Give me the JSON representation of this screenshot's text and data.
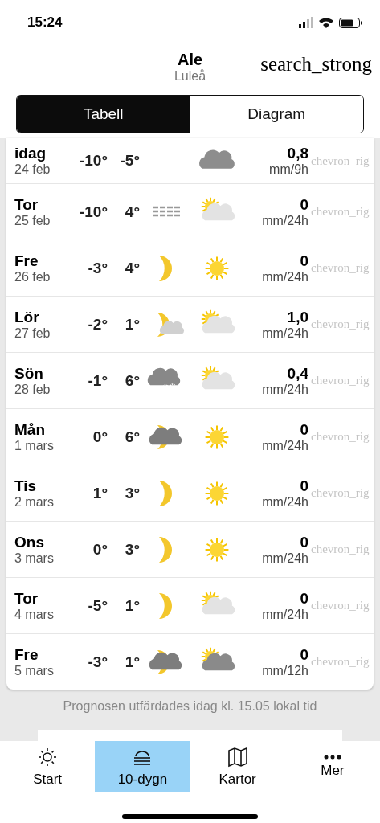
{
  "status_bar": {
    "time": "15:24"
  },
  "header": {
    "title": "Ale",
    "subtitle": "Luleå",
    "search_label": "search_strong"
  },
  "tabs": [
    {
      "label": "Tabell",
      "selected": true
    },
    {
      "label": "Diagram",
      "selected": false
    }
  ],
  "rows": [
    {
      "day": "idag",
      "date": "24 feb",
      "low": "-10°",
      "high": "-5°",
      "day_icon": {
        "kind": "cloud"
      },
      "amount": "0,8",
      "unit": "mm/9h",
      "chevron": "chevron_rig"
    },
    {
      "day": "Tor",
      "date": "25 feb",
      "low": "-10°",
      "high": "4°",
      "night_icon": {
        "kind": "fog"
      },
      "day_icon": {
        "kind": "partlycloudy"
      },
      "amount": "0",
      "unit": "mm/24h",
      "chevron": "chevron_rig"
    },
    {
      "day": "Fre",
      "date": "26 feb",
      "low": "-3°",
      "high": "4°",
      "night_icon": {
        "kind": "moon"
      },
      "day_icon": {
        "kind": "sun"
      },
      "amount": "0",
      "unit": "mm/24h",
      "chevron": "chevron_rig"
    },
    {
      "day": "Lör",
      "date": "27 feb",
      "low": "-2°",
      "high": "1°",
      "night_icon": {
        "kind": "mooncloud"
      },
      "day_icon": {
        "kind": "partlycloudy"
      },
      "amount": "1,0",
      "unit": "mm/24h",
      "chevron": "chevron_rig"
    },
    {
      "day": "Sön",
      "date": "28 feb",
      "low": "-1°",
      "high": "6°",
      "night_icon": {
        "kind": "snow"
      },
      "day_icon": {
        "kind": "partlycloudy"
      },
      "amount": "0,4",
      "unit": "mm/24h",
      "chevron": "chevron_rig"
    },
    {
      "day": "Mån",
      "date": "1 mars",
      "low": "0°",
      "high": "6°",
      "night_icon": {
        "kind": "moonovercast"
      },
      "day_icon": {
        "kind": "sun"
      },
      "amount": "0",
      "unit": "mm/24h",
      "chevron": "chevron_rig"
    },
    {
      "day": "Tis",
      "date": "2 mars",
      "low": "1°",
      "high": "3°",
      "night_icon": {
        "kind": "moon"
      },
      "day_icon": {
        "kind": "sun"
      },
      "amount": "0",
      "unit": "mm/24h",
      "chevron": "chevron_rig"
    },
    {
      "day": "Ons",
      "date": "3 mars",
      "low": "0°",
      "high": "3°",
      "night_icon": {
        "kind": "moon"
      },
      "day_icon": {
        "kind": "sun"
      },
      "amount": "0",
      "unit": "mm/24h",
      "chevron": "chevron_rig"
    },
    {
      "day": "Tor",
      "date": "4 mars",
      "low": "-5°",
      "high": "1°",
      "night_icon": {
        "kind": "moon"
      },
      "day_icon": {
        "kind": "partlycloudy"
      },
      "amount": "0",
      "unit": "mm/24h",
      "chevron": "chevron_rig"
    },
    {
      "day": "Fre",
      "date": "5 mars",
      "low": "-3°",
      "high": "1°",
      "night_icon": {
        "kind": "moonovercast"
      },
      "day_icon": {
        "kind": "sunovercast"
      },
      "amount": "0",
      "unit": "mm/12h",
      "chevron": "chevron_rig"
    }
  ],
  "footer_note": "Prognosen utfärdades idag kl. 15.05 lokal tid",
  "nav": [
    {
      "label": "Start",
      "selected": false
    },
    {
      "label": "10-dygn",
      "selected": true
    },
    {
      "label": "Kartor",
      "selected": false
    },
    {
      "label": "Mer",
      "selected": false
    }
  ]
}
